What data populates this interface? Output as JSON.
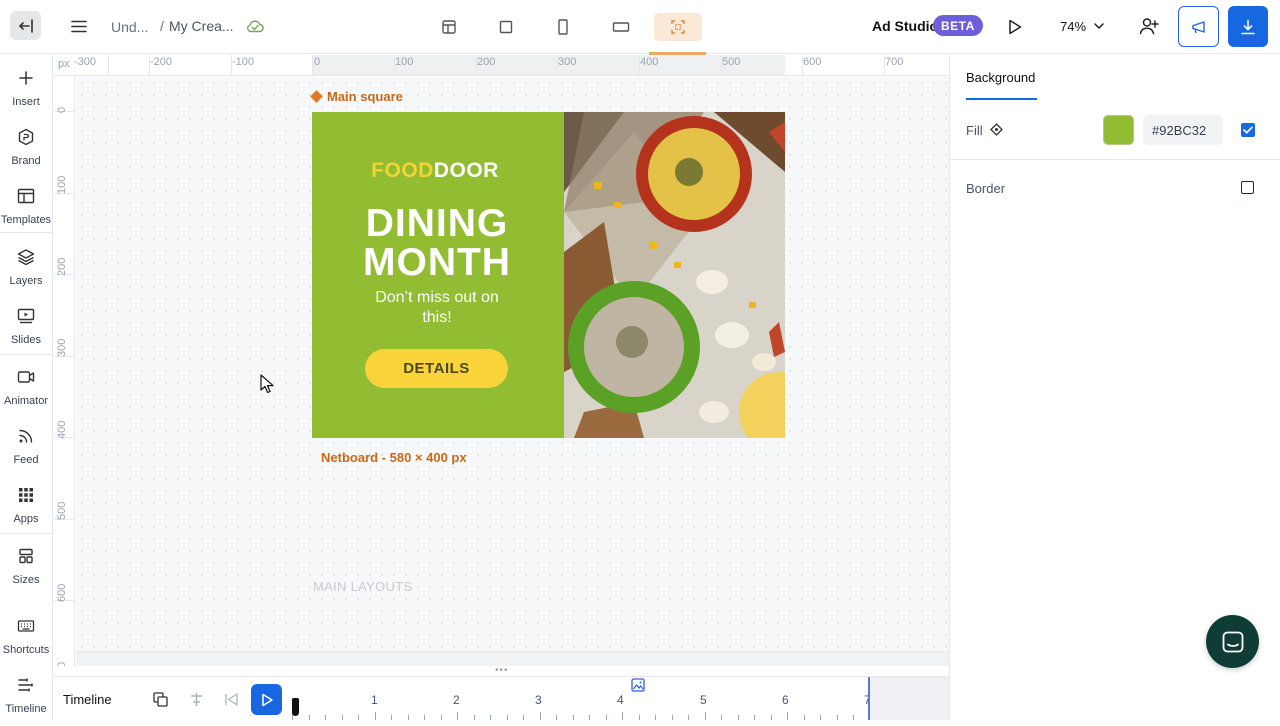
{
  "header": {
    "breadcrumb_folder": "Und...",
    "breadcrumb_separator": "/",
    "breadcrumb_creative": "My Crea...",
    "brand_label": "Ad Studio",
    "beta_badge": "BETA",
    "zoom": "74%",
    "formats": [
      "layout-icon",
      "square-icon",
      "portrait-icon",
      "landscape-icon",
      "fit-screen-icon"
    ]
  },
  "sidebar": {
    "items": [
      {
        "label": "Insert",
        "icon": "plus-icon"
      },
      {
        "label": "Brand",
        "icon": "brand-icon"
      },
      {
        "label": "Templates",
        "icon": "templates-icon"
      },
      {
        "label": "Layers",
        "icon": "layers-icon"
      },
      {
        "label": "Slides",
        "icon": "slides-icon"
      },
      {
        "label": "Animator",
        "icon": "video-icon"
      },
      {
        "label": "Feed",
        "icon": "feed-icon"
      },
      {
        "label": "Apps",
        "icon": "apps-grid-icon"
      },
      {
        "label": "Sizes",
        "icon": "sizes-icon"
      },
      {
        "label": "Shortcuts",
        "icon": "keyboard-icon"
      },
      {
        "label": "Timeline",
        "icon": "timeline-icon"
      }
    ]
  },
  "rulers": {
    "unit": "px",
    "top_labels": [
      "-300",
      "-200",
      "-100",
      "0",
      "100",
      "200",
      "300",
      "400",
      "500",
      "600",
      "700"
    ],
    "left_labels": [
      "0",
      "100",
      "200",
      "300",
      "400",
      "500",
      "600",
      "0"
    ]
  },
  "canvas": {
    "layout_name": "Main square",
    "artboard_caption": "Netboard - 580 × 400 px",
    "section_label": "MAIN LAYOUTS",
    "creative": {
      "logo_part1": "FOOD",
      "logo_part2": "DOOR",
      "headline_line1": "DINING",
      "headline_line2": "MONTH",
      "subtext": "Don’t miss out on this!",
      "cta": "DETAILS",
      "bg_color": "#92BC32"
    }
  },
  "timeline": {
    "title": "Timeline",
    "markers": [
      "1",
      "2",
      "3",
      "4",
      "5",
      "6",
      "7"
    ]
  },
  "panel": {
    "tab": "Background",
    "fill_label": "Fill",
    "fill_color": "#92BC32",
    "fill_hex": "#92BC32",
    "fill_enabled": true,
    "border_label": "Border",
    "border_enabled": false
  }
}
